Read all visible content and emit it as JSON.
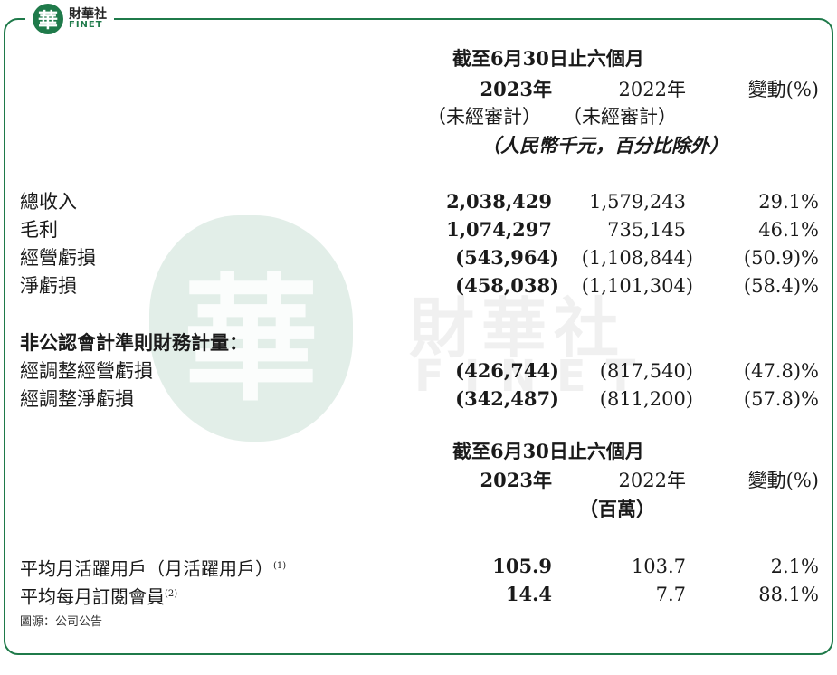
{
  "logo": {
    "cn": "財華社",
    "en": "FINET",
    "seal": "華"
  },
  "watermark": {
    "seal": "華",
    "cn": "財華社",
    "en": "FINET"
  },
  "section1": {
    "period": "截至6月30日止六個月",
    "col_2023": "2023年",
    "col_2022": "2022年",
    "col_change": "變動(%)",
    "audit_2023": "（未經審計）",
    "audit_2022": "（未經審計）",
    "unit": "（人民幣千元，百分比除外）",
    "rows": [
      {
        "label": "總收入",
        "v2023": "2,038,429",
        "v2022": "1,579,243",
        "change": "29.1%"
      },
      {
        "label": "毛利",
        "v2023": "1,074,297",
        "v2022": "735,145",
        "change": "46.1%"
      },
      {
        "label": "經營虧損",
        "v2023": "(543,964)",
        "v2022": "(1,108,844)",
        "change": "(50.9)%"
      },
      {
        "label": "淨虧損",
        "v2023": "(458,038)",
        "v2022": "(1,101,304)",
        "change": "(58.4)%"
      }
    ],
    "nongaap_heading": "非公認會計準則財務計量：",
    "nongaap_rows": [
      {
        "label": "經調整經營虧損",
        "v2023": "(426,744)",
        "v2022": "(817,540)",
        "change": "(47.8)%"
      },
      {
        "label": "經調整淨虧損",
        "v2023": "(342,487)",
        "v2022": "(811,200)",
        "change": "(57.8)%"
      }
    ]
  },
  "section2": {
    "period": "截至6月30日止六個月",
    "col_2023": "2023年",
    "col_2022": "2022年",
    "col_change": "變動(%)",
    "unit": "（百萬）",
    "rows": [
      {
        "label": "平均月活躍用戶（月活躍用戶）",
        "note": "(1)",
        "v2023": "105.9",
        "v2022": "103.7",
        "change": "2.1%"
      },
      {
        "label": "平均每月訂閱會員",
        "note": "(2)",
        "v2023": "14.4",
        "v2022": "7.7",
        "change": "88.1%"
      }
    ]
  },
  "source": "圖源：公司公告"
}
